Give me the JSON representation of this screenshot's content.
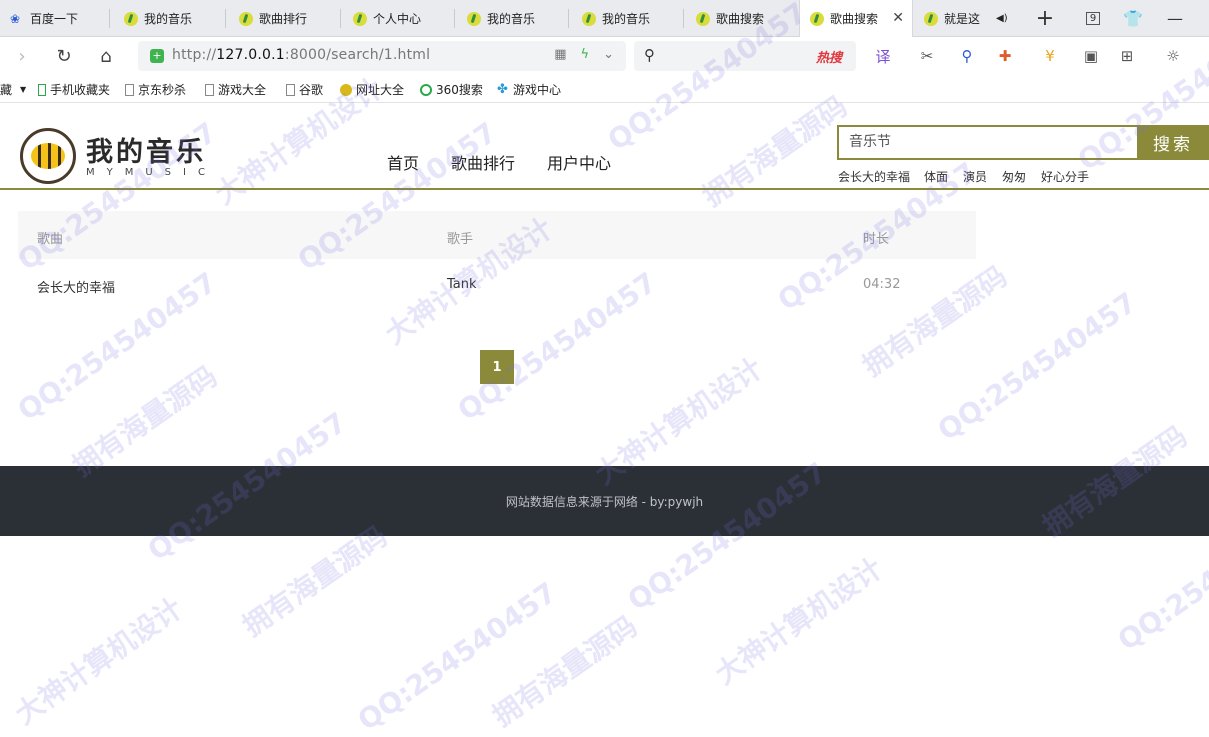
{
  "browser": {
    "tabs": [
      {
        "title": "百度一下"
      },
      {
        "title": "我的音乐"
      },
      {
        "title": "歌曲排行"
      },
      {
        "title": "个人中心"
      },
      {
        "title": "我的音乐"
      },
      {
        "title": "我的音乐"
      },
      {
        "title": "歌曲搜索"
      },
      {
        "title": "歌曲搜索"
      },
      {
        "title": "就是这"
      }
    ],
    "tab_count": "9",
    "url_host": "127.0.0.1",
    "url_rest": ":8000/search/1.html",
    "url_prefix": "http://",
    "search_hot_label": "热搜",
    "bookmarks": [
      {
        "label": "藏"
      },
      {
        "label": "手机收藏夹"
      },
      {
        "label": "京东秒杀"
      },
      {
        "label": "游戏大全"
      },
      {
        "label": "谷歌"
      },
      {
        "label": "网址大全"
      },
      {
        "label": "360搜索"
      },
      {
        "label": "游戏中心"
      }
    ]
  },
  "site": {
    "logo_text": "我的音乐",
    "logo_sub": "MYMUSIC",
    "nav": [
      "首页",
      "歌曲排行",
      "用户中心"
    ],
    "search_value": "音乐节",
    "search_button": "搜索",
    "hot_words": [
      "会长大的幸福",
      "体面",
      "演员",
      "匆匆",
      "好心分手"
    ]
  },
  "table": {
    "headers": [
      "歌曲",
      "歌手",
      "时长"
    ],
    "rows": [
      {
        "song": "会长大的幸福",
        "singer": "Tank",
        "duration": "04:32"
      }
    ]
  },
  "pagination": {
    "current": "1"
  },
  "footer": {
    "text": "网站数据信息来源于网络 - by:pywjh"
  },
  "watermarks": [
    "QQ:254540457",
    "拥有海量源码",
    "大神计算机设计"
  ],
  "colors": {
    "accent": "#8a8a3a",
    "footer_bg": "#2b3036"
  }
}
